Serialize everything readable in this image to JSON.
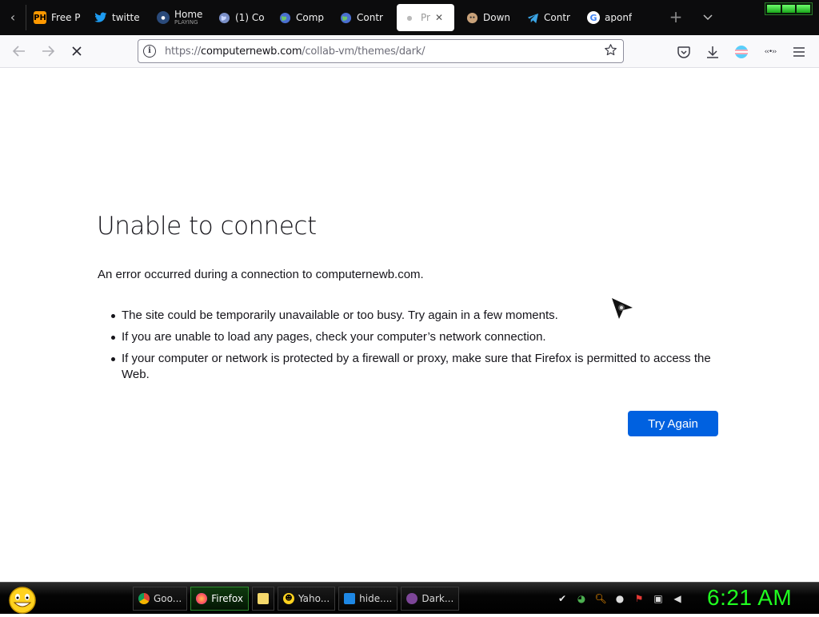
{
  "browser": {
    "tabs": [
      {
        "title": "Free P",
        "sub": "",
        "icon": "ph-icon",
        "icon_text": "PH",
        "active": false
      },
      {
        "title": "twitte",
        "sub": "",
        "icon": "twitter-bird-icon",
        "icon_text": "",
        "active": false
      },
      {
        "title": "Home",
        "sub": "PLAYING",
        "icon": "site-logo-icon",
        "icon_text": "",
        "active": false
      },
      {
        "title": "(1) Co",
        "sub": "",
        "icon": "globe-icon",
        "icon_text": "",
        "active": false
      },
      {
        "title": "Comp",
        "sub": "",
        "icon": "globe-icon",
        "icon_text": "",
        "active": false
      },
      {
        "title": "Contr",
        "sub": "",
        "icon": "globe-icon",
        "icon_text": "",
        "active": false
      },
      {
        "title": "Pr",
        "sub": "",
        "icon": "loading-dot-icon",
        "icon_text": "",
        "active": true
      },
      {
        "title": "Down",
        "sub": "",
        "icon": "download-site-icon",
        "icon_text": "",
        "active": false
      },
      {
        "title": "Contr",
        "sub": "",
        "icon": "telegram-icon",
        "icon_text": "",
        "active": false
      },
      {
        "title": "aponf",
        "sub": "",
        "icon": "google-icon",
        "icon_text": "",
        "active": false
      }
    ],
    "url": {
      "prefix": "https://",
      "domain": "computernewb.com",
      "path": "/collab-vm/themes/dark/"
    }
  },
  "error": {
    "title": "Unable to connect",
    "description": "An error occurred during a connection to computernewb.com.",
    "items": [
      "The site could be temporarily unavailable or too busy. Try again in a few moments.",
      "If you are unable to load any pages, check your computer’s network connection.",
      "If your computer or network is protected by a firewall or proxy, make sure that Firefox is permitted to access the Web."
    ],
    "try_again_label": "Try Again"
  },
  "taskbar": {
    "items": [
      {
        "label": "Goo...",
        "icon": "chrome-icon",
        "active": false
      },
      {
        "label": "Firefox",
        "icon": "firefox-icon",
        "active": true
      },
      {
        "label": "",
        "icon": "folder-icon",
        "active": false
      },
      {
        "label": "Yaho...",
        "icon": "yahoo-smiley-icon",
        "active": false
      },
      {
        "label": "hide....",
        "icon": "hide-vpn-icon",
        "active": false
      },
      {
        "label": "Dark...",
        "icon": "tor-icon",
        "active": false
      }
    ],
    "clock": "6:21 AM"
  },
  "colors": {
    "accent": "#0061e0",
    "clock": "#20ff20",
    "tabstrip_bg": "#0c0c0d"
  }
}
